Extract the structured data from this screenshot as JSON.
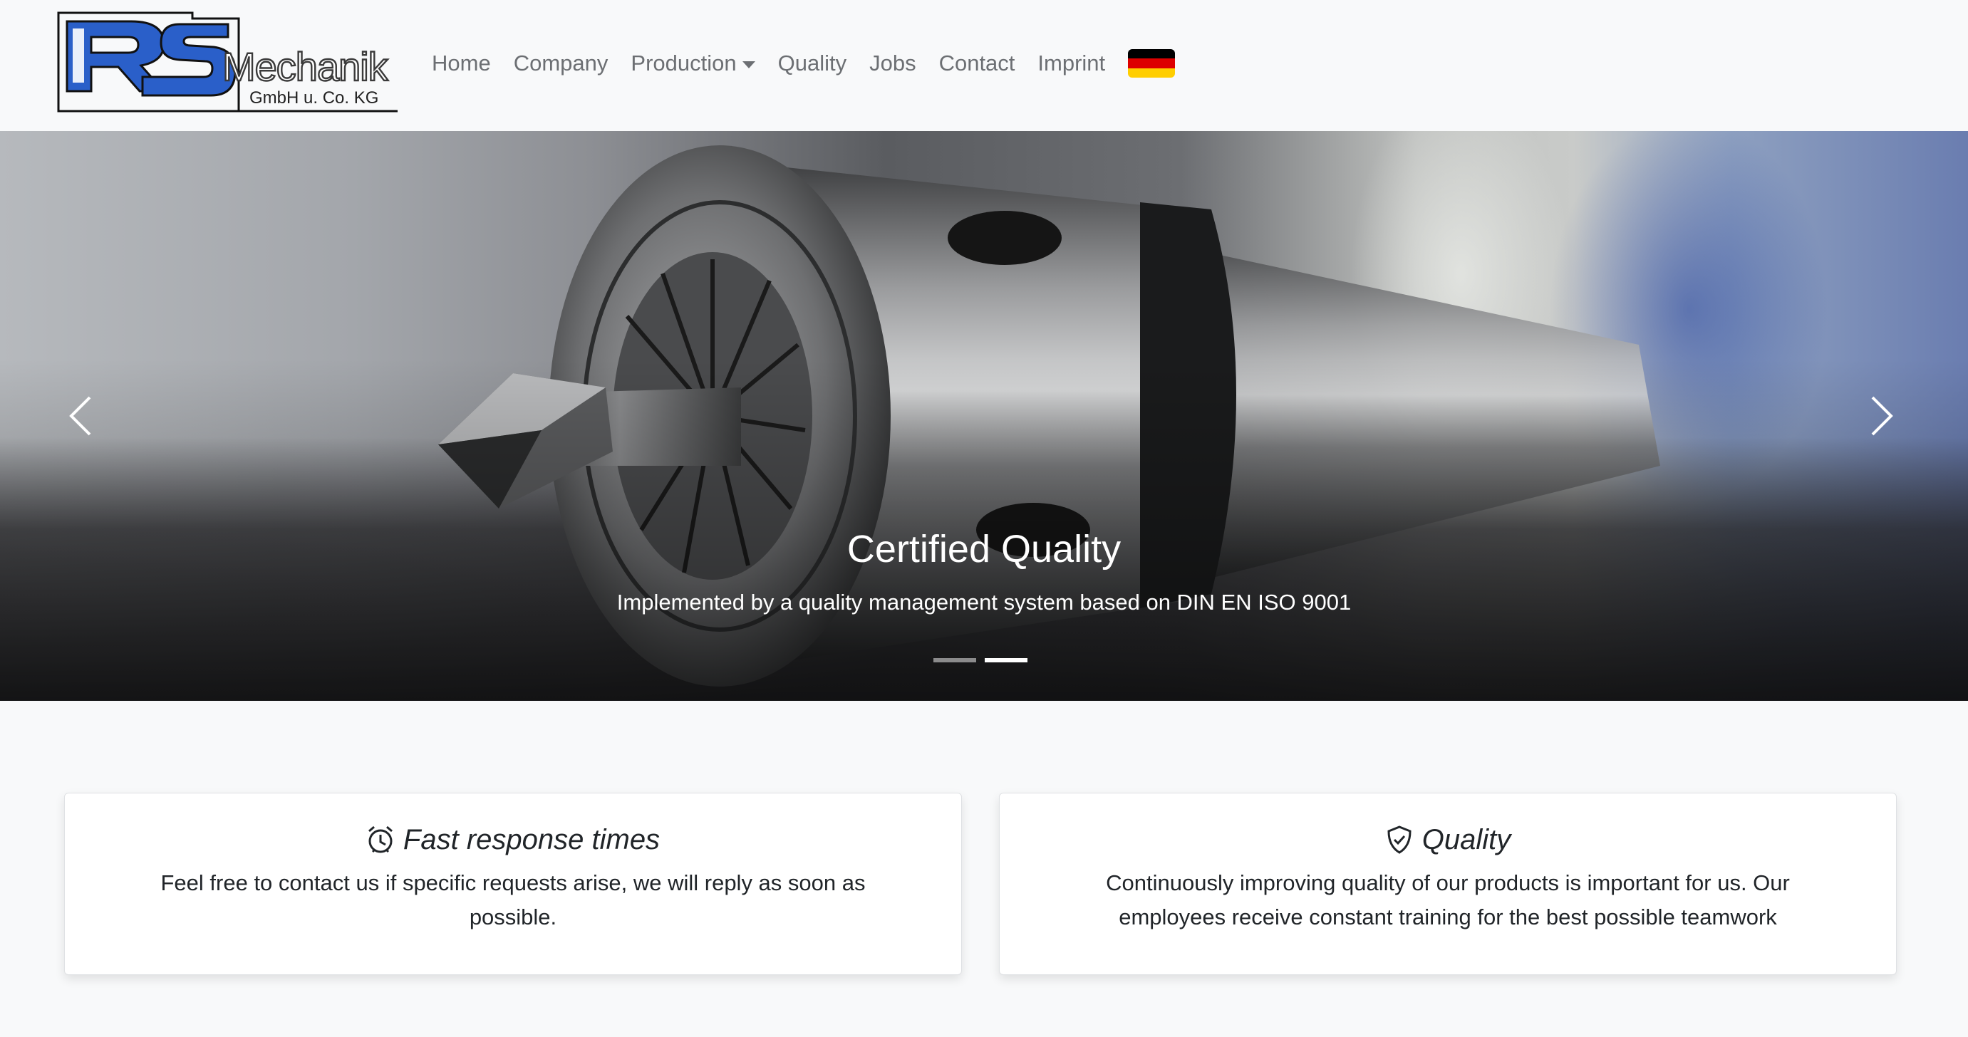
{
  "brand": {
    "word": "Mechanik",
    "subtitle": "GmbH u. Co. KG",
    "letters": "RS",
    "color": "#2a5fc9"
  },
  "nav": {
    "items": [
      {
        "label": "Home"
      },
      {
        "label": "Company"
      },
      {
        "label": "Production"
      },
      {
        "label": "Quality"
      },
      {
        "label": "Jobs"
      },
      {
        "label": "Contact"
      },
      {
        "label": "Imprint"
      }
    ],
    "language_flag": "germany-flag",
    "flag_colors": [
      "#000000",
      "#dd0000",
      "#ffce00"
    ]
  },
  "carousel": {
    "slide_title": "Certified Quality",
    "slide_text": "Implemented by a quality management system based on DIN EN ISO 9001",
    "indicators_count": 2,
    "active_index": 1,
    "prev_icon": "chevron-left-icon",
    "next_icon": "chevron-right-icon"
  },
  "features": [
    {
      "icon": "alarm-clock-icon",
      "title": "Fast response times",
      "text": "Feel free to contact us if specific requests arise, we will reply as soon as possible."
    },
    {
      "icon": "shield-check-icon",
      "title": "Quality",
      "text": "Continuously improving quality of our products is important for us. Our employees receive constant training for the best possible teamwork"
    }
  ],
  "colors": {
    "page_bg": "#f8f9fa",
    "nav_text": "#6c6f73",
    "text_dark": "#212529"
  }
}
